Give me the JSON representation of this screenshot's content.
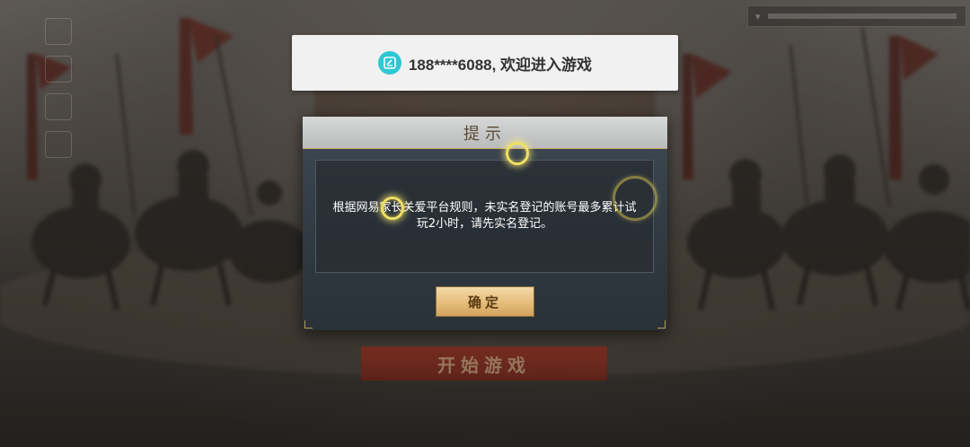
{
  "toast": {
    "message": "188****6088, 欢迎进入游戏",
    "icon": "netease-account-icon",
    "icon_color": "#2ec7d4"
  },
  "dialog": {
    "title": "提示",
    "message": "根据网易家长关爱平台规则，未实名登记的账号最多累计试玩2小时，请先实名登记。",
    "confirm_label": "确定"
  },
  "background": {
    "start_button_label": "开始游戏"
  },
  "colors": {
    "dialog_bg": "#323b43",
    "button_gold": "#e5bd7b",
    "start_red": "#7a2418"
  }
}
